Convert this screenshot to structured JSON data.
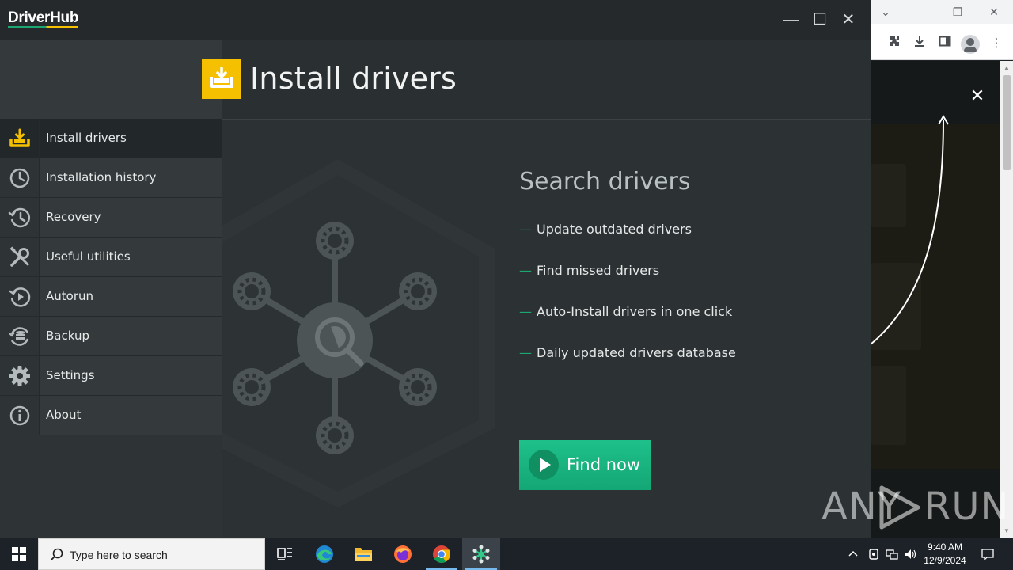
{
  "app": {
    "logo": "DriverHub",
    "window_controls": {
      "minimize": "—",
      "maximize": "☐",
      "close": "✕"
    },
    "header_title": "Install drivers"
  },
  "sidebar": {
    "items": [
      {
        "label": "Install drivers",
        "icon": "install-drivers-icon",
        "active": true
      },
      {
        "label": "Installation history",
        "icon": "clock-icon"
      },
      {
        "label": "Recovery",
        "icon": "history-restore-icon"
      },
      {
        "label": "Useful utilities",
        "icon": "tools-icon"
      },
      {
        "label": "Autorun",
        "icon": "autorun-icon"
      },
      {
        "label": "Backup",
        "icon": "backup-icon"
      },
      {
        "label": "Settings",
        "icon": "gear-icon"
      },
      {
        "label": "About",
        "icon": "info-icon"
      }
    ]
  },
  "main": {
    "title": "Search drivers",
    "features": [
      "Update outdated drivers",
      "Find missed drivers",
      "Auto-Install drivers in one click",
      "Daily updated drivers database"
    ],
    "feature_dash": "—",
    "cta_label": "Find now"
  },
  "browser": {
    "ad_close": "✕"
  },
  "watermark": {
    "left": "ANY",
    "right": "RUN"
  },
  "taskbar": {
    "search_placeholder": "Type here to search",
    "time": "9:40 AM",
    "date": "12/9/2024"
  },
  "colors": {
    "accent_yellow": "#f5c000",
    "accent_green": "#1ba672",
    "window_bg": "#2c3133"
  }
}
